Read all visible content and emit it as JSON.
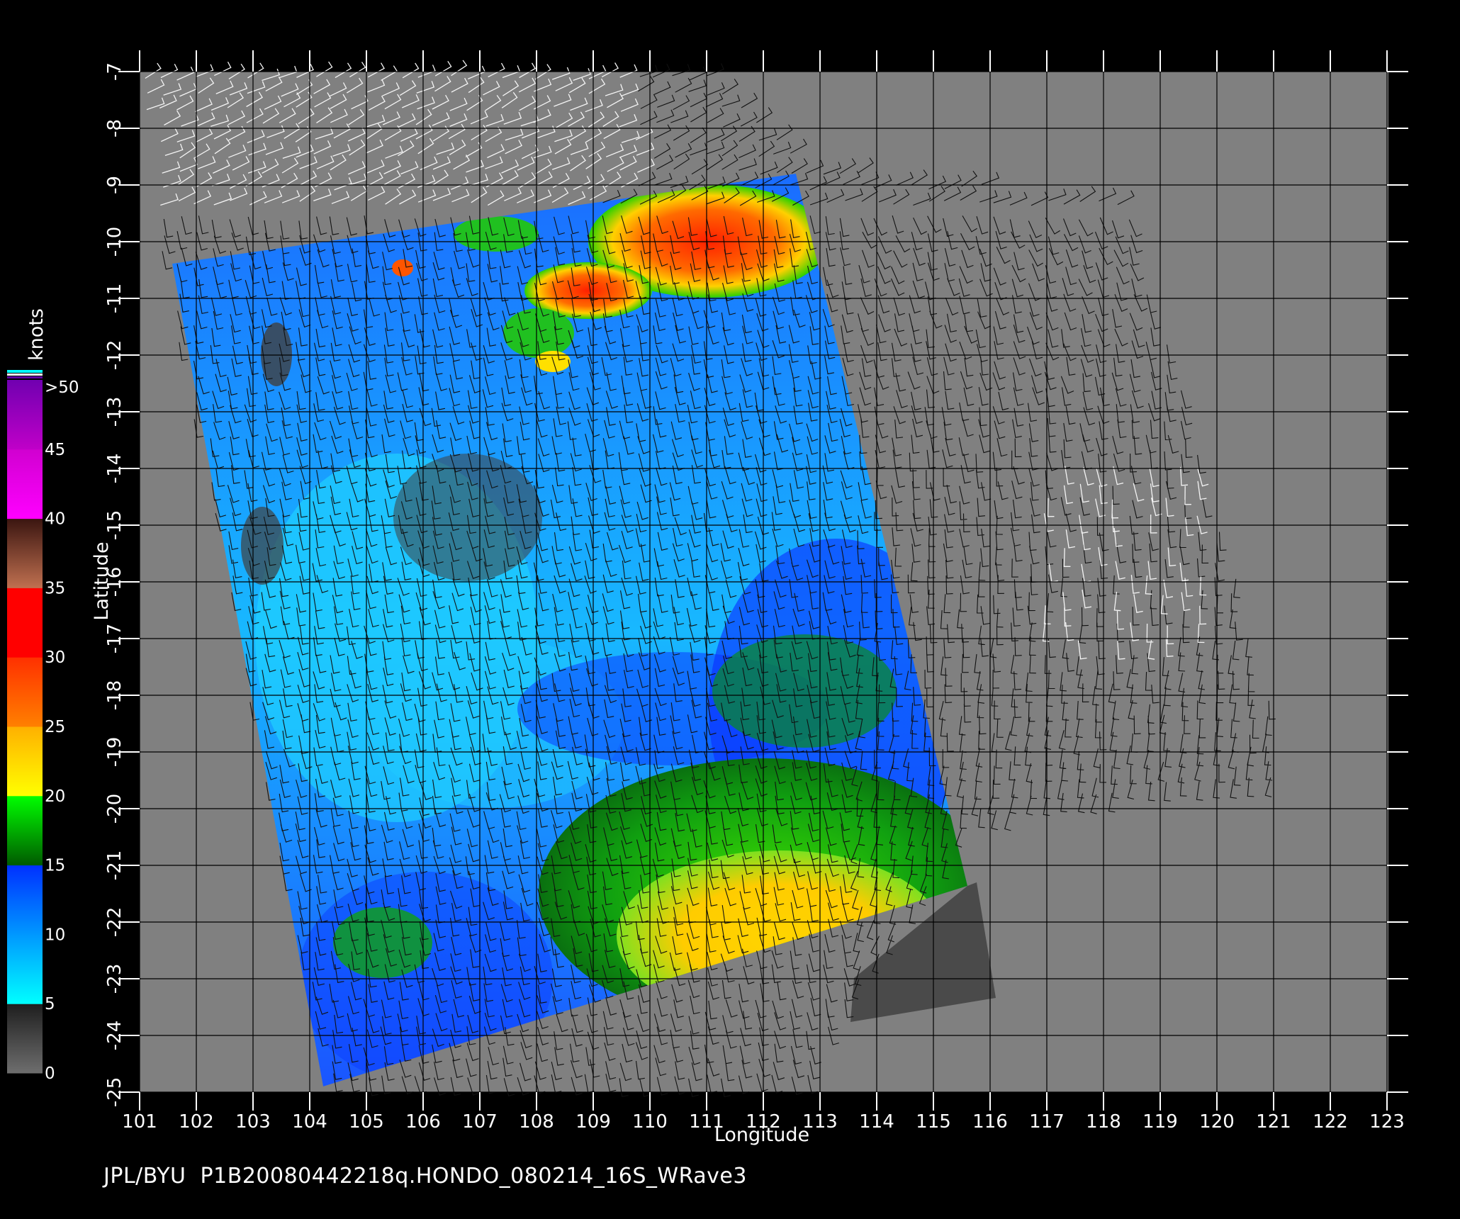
{
  "map": {
    "lon_ticks": [
      "101",
      "102",
      "103",
      "104",
      "105",
      "106",
      "107",
      "108",
      "109",
      "110",
      "111",
      "112",
      "113",
      "114",
      "115",
      "116",
      "117",
      "118",
      "119",
      "120",
      "121",
      "122",
      "123"
    ],
    "lat_ticks": [
      "-7",
      "-8",
      "-9",
      "-10",
      "-11",
      "-12",
      "-13",
      "-14",
      "-15",
      "-16",
      "-17",
      "-18",
      "-19",
      "-20",
      "-21",
      "-22",
      "-23",
      "-24",
      "-25"
    ],
    "xlabel": "Longitude",
    "ylabel": "Latitude",
    "extent": {
      "lon": [
        101,
        123
      ],
      "lat": [
        -25,
        -7
      ]
    },
    "background_color": "#808080",
    "grid": true,
    "wind_barbs": true
  },
  "colorbar": {
    "title": "knots",
    "labels": [
      ">50",
      "45",
      "40",
      "35",
      "30",
      "25",
      "20",
      "15",
      "10",
      "5",
      "0"
    ],
    "bands": [
      {
        "from": 0,
        "to": 5,
        "colors": [
          "#6e6e6e",
          "#1e1e1e"
        ]
      },
      {
        "from": 5,
        "to": 15,
        "colors": [
          "#00ffff",
          "#0030ff"
        ]
      },
      {
        "from": 15,
        "to": 20,
        "colors": [
          "#005a00",
          "#00ff00"
        ]
      },
      {
        "from": 20,
        "to": 25,
        "colors": [
          "#ffff00",
          "#ffb000"
        ]
      },
      {
        "from": 25,
        "to": 30,
        "colors": [
          "#ff8000",
          "#ff3000"
        ]
      },
      {
        "from": 30,
        "to": 35,
        "colors": [
          "#ff0000",
          "#ff0000"
        ]
      },
      {
        "from": 35,
        "to": 40,
        "colors": [
          "#c07050",
          "#3a1510"
        ]
      },
      {
        "from": 40,
        "to": 45,
        "colors": [
          "#ff00ff",
          "#d000d0"
        ]
      },
      {
        "from": 45,
        "to": 50,
        "colors": [
          "#c000c8",
          "#7000b0"
        ]
      }
    ]
  },
  "footer": "JPL/BYU  P1B20080442218q.HONDO_080214_16S_WRave3"
}
